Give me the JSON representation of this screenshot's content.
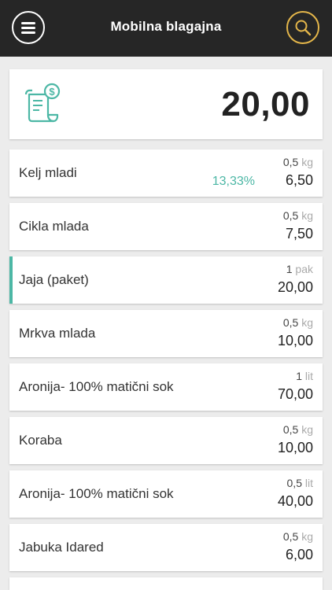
{
  "header": {
    "title": "Mobilna blagajna",
    "menu_icon": "hamburger-menu-icon",
    "search_icon": "search-icon",
    "search_color": "#e4b64a"
  },
  "summary": {
    "icon": "receipt-dollar-icon",
    "total": "20,00"
  },
  "accent_color": "#4cb7a5",
  "items": [
    {
      "name": "Kelj mladi",
      "qty": "0,5",
      "unit": "kg",
      "price": "6,50",
      "discount": "13,33%"
    },
    {
      "name": "Cikla mlada",
      "qty": "0,5",
      "unit": "kg",
      "price": "7,50",
      "discount": ""
    },
    {
      "name": "Jaja (paket)",
      "qty": "1",
      "unit": "pak",
      "price": "20,00",
      "discount": "",
      "selected": true
    },
    {
      "name": "Mrkva mlada",
      "qty": "0,5",
      "unit": "kg",
      "price": "10,00",
      "discount": ""
    },
    {
      "name": "Aronija- 100% matični sok",
      "qty": "1",
      "unit": "lit",
      "price": "70,00",
      "discount": ""
    },
    {
      "name": "Koraba",
      "qty": "0,5",
      "unit": "kg",
      "price": "10,00",
      "discount": ""
    },
    {
      "name": "Aronija- 100% matični sok",
      "qty": "0,5",
      "unit": "lit",
      "price": "40,00",
      "discount": ""
    },
    {
      "name": "Jabuka Idared",
      "qty": "0,5",
      "unit": "kg",
      "price": "6,00",
      "discount": ""
    }
  ]
}
